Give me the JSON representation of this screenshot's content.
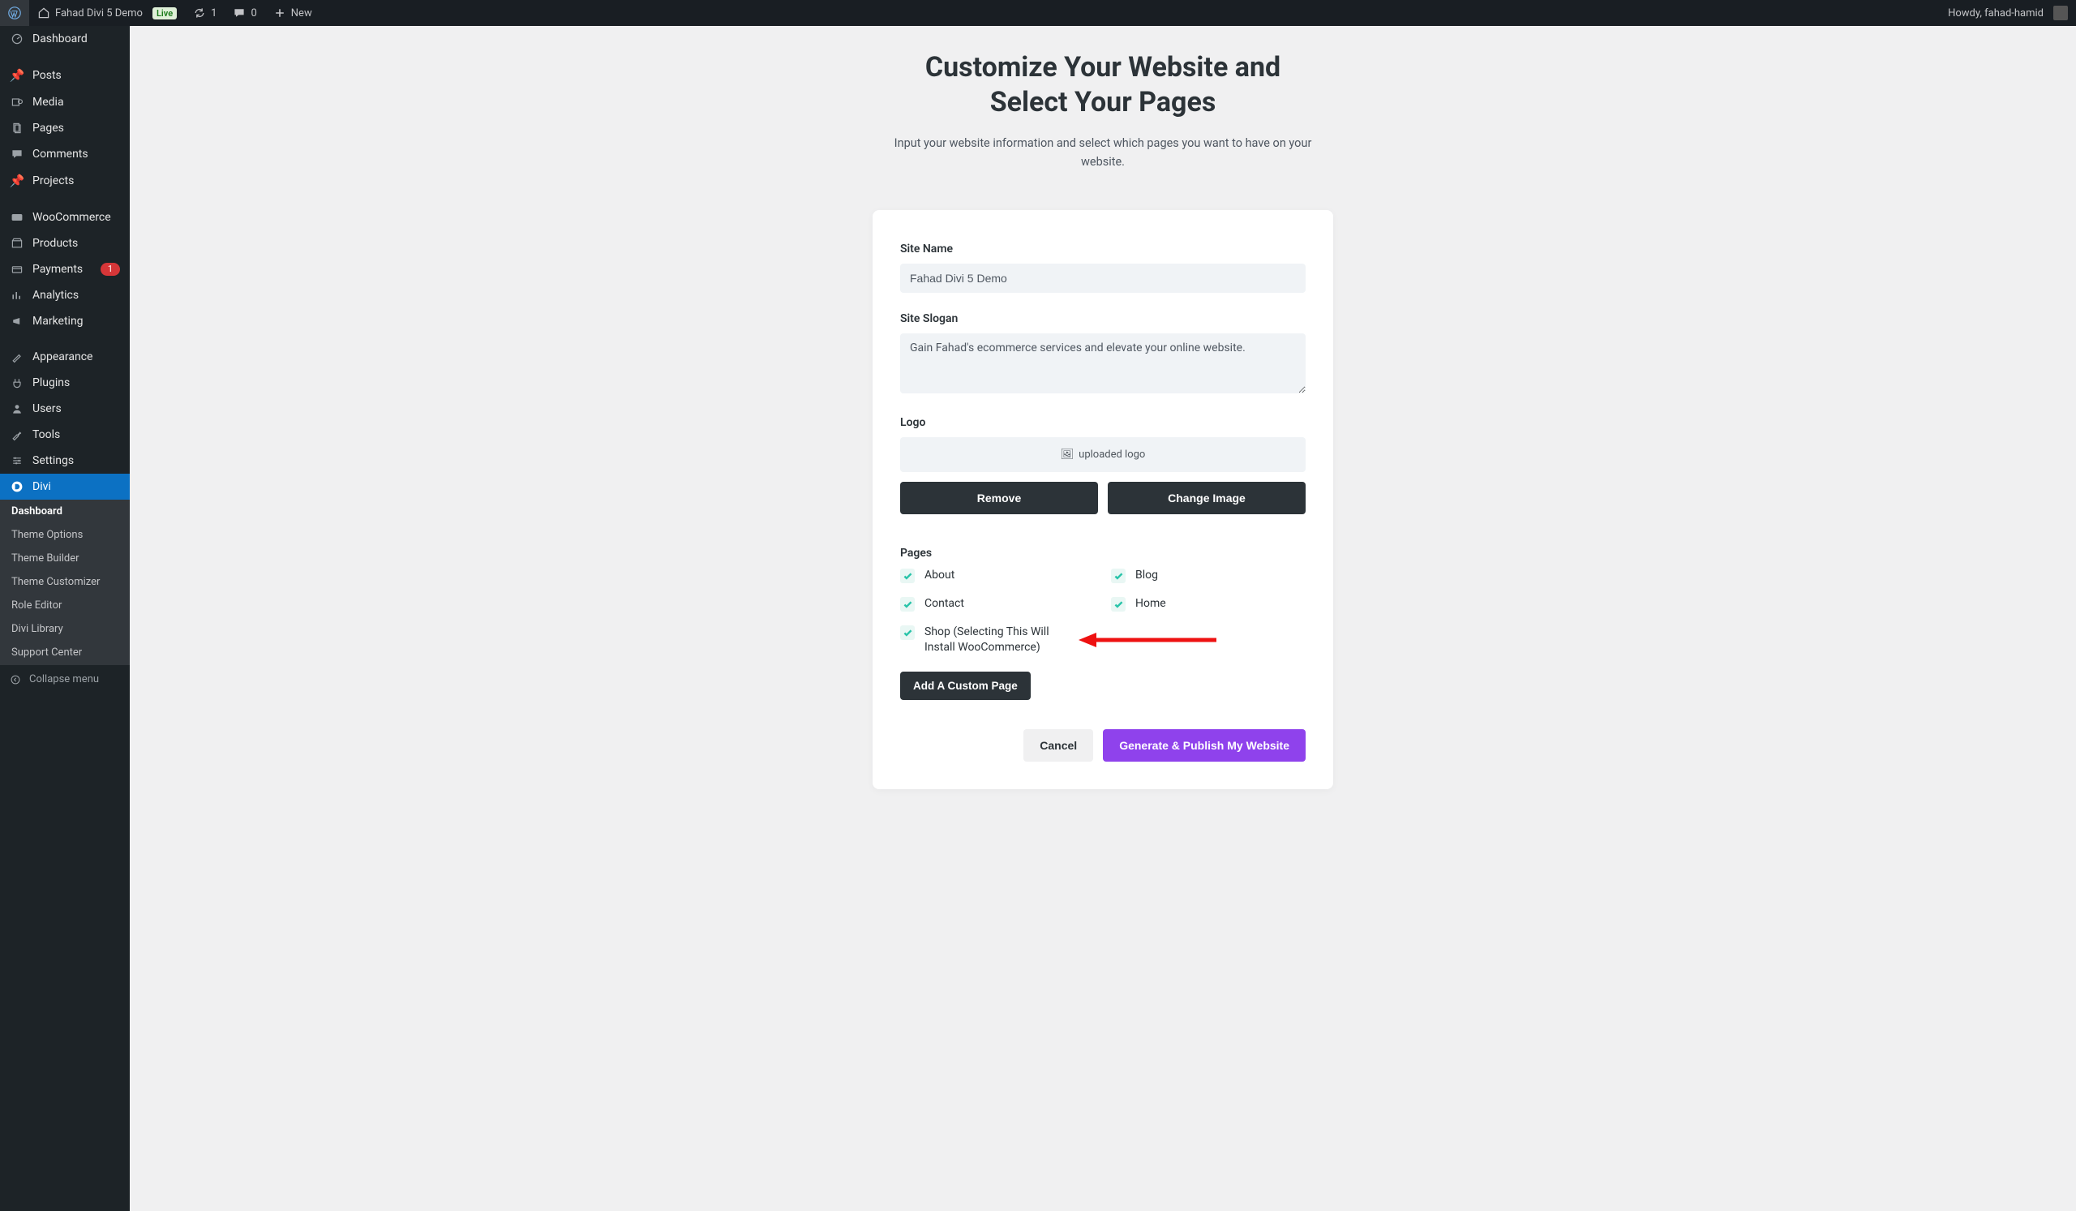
{
  "adminbar": {
    "site_title": "Fahad Divi 5 Demo",
    "live_badge": "Live",
    "updates_count": "1",
    "comments_count": "0",
    "new_label": "New",
    "howdy": "Howdy, fahad-hamid"
  },
  "sidebar": {
    "items": [
      {
        "label": "Dashboard",
        "icon": "dashboard"
      },
      {
        "label": "Posts",
        "icon": "pin"
      },
      {
        "label": "Media",
        "icon": "media"
      },
      {
        "label": "Pages",
        "icon": "pages"
      },
      {
        "label": "Comments",
        "icon": "comment"
      },
      {
        "label": "Projects",
        "icon": "pin"
      },
      {
        "label": "WooCommerce",
        "icon": "woo"
      },
      {
        "label": "Products",
        "icon": "archive"
      },
      {
        "label": "Payments",
        "icon": "payments",
        "badge": "1"
      },
      {
        "label": "Analytics",
        "icon": "analytics"
      },
      {
        "label": "Marketing",
        "icon": "marketing"
      },
      {
        "label": "Appearance",
        "icon": "brush"
      },
      {
        "label": "Plugins",
        "icon": "plug"
      },
      {
        "label": "Users",
        "icon": "user"
      },
      {
        "label": "Tools",
        "icon": "wrench"
      },
      {
        "label": "Settings",
        "icon": "sliders"
      },
      {
        "label": "Divi",
        "icon": "divi",
        "active": true
      }
    ],
    "submenu": [
      {
        "label": "Dashboard",
        "active": true
      },
      {
        "label": "Theme Options"
      },
      {
        "label": "Theme Builder"
      },
      {
        "label": "Theme Customizer"
      },
      {
        "label": "Role Editor"
      },
      {
        "label": "Divi Library"
      },
      {
        "label": "Support Center"
      }
    ],
    "collapse": "Collapse menu"
  },
  "hero": {
    "title_l1": "Customize Your Website and",
    "title_l2": "Select Your Pages",
    "sub": "Input your website information and select which pages you want to have on your website."
  },
  "form": {
    "site_name_label": "Site Name",
    "site_name_value": "Fahad Divi 5 Demo",
    "slogan_label": "Site Slogan",
    "slogan_value": "Gain Fahad's ecommerce services and elevate your online website.",
    "logo_label": "Logo",
    "logo_placeholder": "uploaded logo",
    "remove_btn": "Remove",
    "change_btn": "Change Image",
    "pages_label": "Pages",
    "pages": [
      {
        "label": "About",
        "checked": true
      },
      {
        "label": "Blog",
        "checked": true
      },
      {
        "label": "Contact",
        "checked": true
      },
      {
        "label": "Home",
        "checked": true
      },
      {
        "label": "Shop (Selecting This Will Install WooCommerce)",
        "checked": true,
        "wide": true
      }
    ],
    "add_page_btn": "Add A Custom Page",
    "cancel_btn": "Cancel",
    "generate_btn": "Generate & Publish My Website"
  }
}
